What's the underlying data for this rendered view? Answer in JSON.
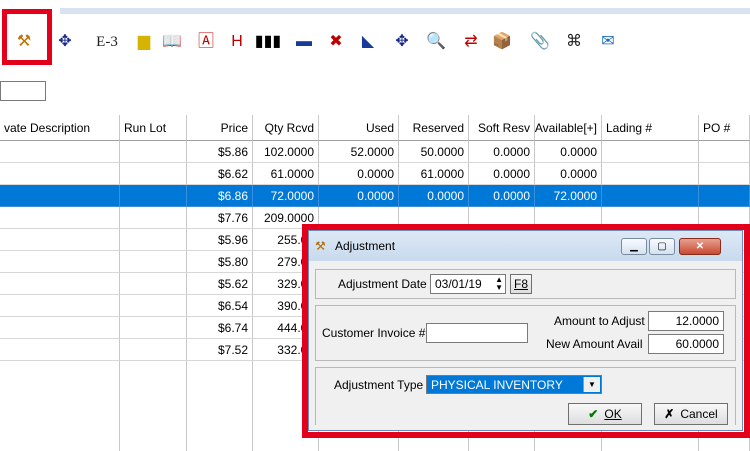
{
  "toolbar": {
    "items": [
      {
        "name": "adjustment-tool-icon",
        "glyph": "⚒",
        "color": "#c07000"
      },
      {
        "name": "move-icon",
        "glyph": "✥",
        "color": "#1a2a8a"
      },
      {
        "name": "e3-label",
        "glyph": "E-3",
        "color": "#202020"
      },
      {
        "name": "note-icon",
        "glyph": "▆",
        "color": "#d4b400"
      },
      {
        "name": "book-icon",
        "glyph": "📖",
        "color": "#303030"
      },
      {
        "name": "document-a-icon",
        "glyph": "🄰",
        "color": "#c00000"
      },
      {
        "name": "h-badge-icon",
        "glyph": "H",
        "color": "#c00000"
      },
      {
        "name": "barcode-icon",
        "glyph": "▮▮▮",
        "color": "#000000"
      },
      {
        "name": "truck-icon",
        "glyph": "▬",
        "color": "#1a3a9a"
      },
      {
        "name": "no-truck-icon",
        "glyph": "✖",
        "color": "#c00000"
      },
      {
        "name": "truck-alt-icon",
        "glyph": "◣",
        "color": "#1a3a9a"
      },
      {
        "name": "move-alt-icon",
        "glyph": "✥",
        "color": "#1a2a8a"
      },
      {
        "name": "search-icon",
        "glyph": "🔍",
        "color": "#1a3a9a"
      },
      {
        "name": "transfer-arrows-icon",
        "glyph": "⇄",
        "color": "#c00000"
      },
      {
        "name": "package-icon",
        "glyph": "📦",
        "color": "#c08020"
      },
      {
        "name": "paperclip-icon",
        "glyph": "📎",
        "color": "#404040"
      },
      {
        "name": "binoculars-icon",
        "glyph": "⌘",
        "color": "#202020"
      },
      {
        "name": "mail-icon",
        "glyph": "✉",
        "color": "#1a6ac0"
      }
    ]
  },
  "grid": {
    "headers": [
      "vate Description",
      "Run Lot",
      "Price",
      "Qty Rcvd",
      "Used",
      "Reserved",
      "Soft Resv",
      "Available[+]",
      "Lading #",
      "PO #"
    ],
    "rows": [
      {
        "price": "$5.86",
        "qty": "102.0000",
        "used": "52.0000",
        "reserved": "50.0000",
        "soft": "0.0000",
        "avail": "0.0000"
      },
      {
        "price": "$6.62",
        "qty": "61.0000",
        "used": "0.0000",
        "reserved": "61.0000",
        "soft": "0.0000",
        "avail": "0.0000"
      },
      {
        "price": "$6.86",
        "qty": "72.0000",
        "used": "0.0000",
        "reserved": "0.0000",
        "soft": "0.0000",
        "avail": "72.0000"
      },
      {
        "price": "$7.76",
        "qty": "209.0000",
        "used": "",
        "reserved": "",
        "soft": "",
        "avail": ""
      },
      {
        "price": "$5.96",
        "qty": "255.00",
        "used": "",
        "reserved": "",
        "soft": "",
        "avail": ""
      },
      {
        "price": "$5.80",
        "qty": "279.00",
        "used": "",
        "reserved": "",
        "soft": "",
        "avail": ""
      },
      {
        "price": "$5.62",
        "qty": "329.00",
        "used": "",
        "reserved": "",
        "soft": "",
        "avail": ""
      },
      {
        "price": "$6.54",
        "qty": "390.00",
        "used": "",
        "reserved": "",
        "soft": "",
        "avail": ""
      },
      {
        "price": "$6.74",
        "qty": "444.00",
        "used": "",
        "reserved": "",
        "soft": "",
        "avail": ""
      },
      {
        "price": "$7.52",
        "qty": "332.00",
        "used": "",
        "reserved": "",
        "soft": "",
        "avail": ""
      }
    ],
    "selected_row": 2,
    "selection_color": "#0078d7"
  },
  "dialog": {
    "title": "Adjustment",
    "adjustment_date_label": "Adjustment Date",
    "adjustment_date": "03/01/19",
    "f8_label": "F8",
    "customer_invoice_label": "Customer Invoice #",
    "customer_invoice": "",
    "amount_to_adjust_label": "Amount to Adjust",
    "amount_to_adjust": "12.0000",
    "new_amount_avail_label": "New Amount Avail",
    "new_amount_avail": "60.0000",
    "adjustment_type_label": "Adjustment Type",
    "adjustment_type": "PHYSICAL INVENTORY",
    "ok_label": "OK",
    "cancel_label": "Cancel"
  },
  "highlight_color": "#e3001b"
}
